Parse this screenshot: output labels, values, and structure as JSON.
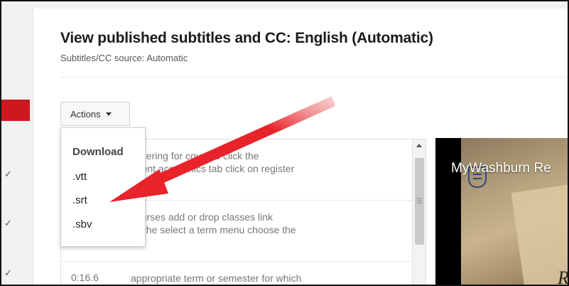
{
  "header": {
    "title": "View published subtitles and CC: English (Automatic)",
    "subtitle": "Subtitles/CC source: Automatic"
  },
  "actions": {
    "label": "Actions"
  },
  "menu": {
    "heading": "Download",
    "items": [
      ".vtt",
      ".srt",
      ".sbv"
    ]
  },
  "transcript": {
    "rows": [
      {
        "time": "",
        "text": "gistering for courses click the\nudent academics tab click on register"
      },
      {
        "time": "",
        "text": "courses add or drop classes link\nck the select a term menu choose the"
      },
      {
        "time": "0:16.6",
        "text": "appropriate term or semester for which"
      }
    ]
  },
  "video": {
    "title": "MyWashburn Re",
    "corner_letter": "R"
  },
  "sidebar": {
    "checks": [
      "✓",
      "✓",
      "✓"
    ]
  },
  "colors": {
    "accent_red": "#cc181e",
    "arrow_red": "#e8232a"
  },
  "icons": {
    "actions_caret": "caret-down-icon",
    "scroll_up": "chevron-up-icon",
    "arrow": "arrow-annotation-icon"
  }
}
